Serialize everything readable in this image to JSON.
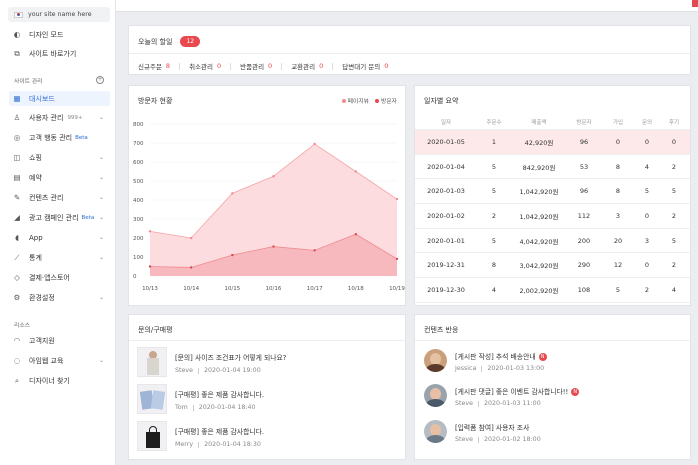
{
  "sidebar": {
    "site_name": "your site name here",
    "top_items": [
      {
        "icon": "palette-icon",
        "label": "디자인 모드"
      },
      {
        "icon": "external-link-icon",
        "label": "사이트 바로가기"
      }
    ],
    "section1": "사이트 관리",
    "items": [
      {
        "icon": "dashboard-icon",
        "label": "대시보드",
        "active": true
      },
      {
        "icon": "user-icon",
        "label": "사용자 관리",
        "count": "999+"
      },
      {
        "icon": "target-icon",
        "label": "고객 행동 관리",
        "beta": "Beta"
      },
      {
        "icon": "bag-icon",
        "label": "쇼핑"
      },
      {
        "icon": "calendar-icon",
        "label": "예약"
      },
      {
        "icon": "edit-icon",
        "label": "컨텐츠 관리"
      },
      {
        "icon": "megaphone-icon",
        "label": "광고 캠페인 관리",
        "beta": "Beta"
      },
      {
        "icon": "app-icon",
        "label": "App"
      },
      {
        "icon": "stats-icon",
        "label": "통계"
      },
      {
        "icon": "store-icon",
        "label": "결제·앱스토어"
      },
      {
        "icon": "settings-icon",
        "label": "환경설정"
      }
    ],
    "section2": "리소스",
    "resources": [
      {
        "icon": "headset-icon",
        "label": "고객지원"
      },
      {
        "icon": "bulb-icon",
        "label": "아임웹 교육"
      },
      {
        "icon": "search-icon",
        "label": "디자이너 찾기"
      }
    ]
  },
  "todo": {
    "title": "오늘의 할일",
    "count": "12",
    "items": [
      {
        "label": "신규주문",
        "value": "8"
      },
      {
        "label": "취소관리",
        "value": "0"
      },
      {
        "label": "반품관리",
        "value": "0"
      },
      {
        "label": "교환관리",
        "value": "0"
      },
      {
        "label": "답변대기 문의",
        "value": "0"
      }
    ]
  },
  "visitor": {
    "title": "방문자 현황",
    "legend": [
      {
        "label": "페이지뷰",
        "color": "#f28a8f"
      },
      {
        "label": "방문자",
        "color": "#e9484f"
      }
    ]
  },
  "chart_data": {
    "type": "area",
    "x": [
      "10/13",
      "10/14",
      "10/15",
      "10/16",
      "10/17",
      "10/18",
      "10/19"
    ],
    "ylim": [
      0,
      800
    ],
    "yticks": [
      0,
      100,
      200,
      300,
      400,
      500,
      600,
      700,
      800
    ],
    "series": [
      {
        "name": "페이지뷰",
        "values": [
          235,
          200,
          435,
          525,
          695,
          550,
          405
        ],
        "color": "#f8b9bc"
      },
      {
        "name": "방문자",
        "values": [
          50,
          45,
          110,
          155,
          135,
          220,
          90
        ],
        "color": "#f08a90"
      }
    ]
  },
  "daily": {
    "title": "일자별 요약",
    "headers": [
      "일자",
      "주문수",
      "매출액",
      "방문자",
      "가입",
      "문의",
      "후기"
    ],
    "rows": [
      [
        "2020-01-05",
        "1",
        "42,920원",
        "96",
        "0",
        "0",
        "0"
      ],
      [
        "2020-01-04",
        "5",
        "842,920원",
        "53",
        "8",
        "4",
        "2"
      ],
      [
        "2020-01-03",
        "5",
        "1,042,920원",
        "96",
        "8",
        "5",
        "5"
      ],
      [
        "2020-01-02",
        "2",
        "1,042,920원",
        "112",
        "3",
        "0",
        "2"
      ],
      [
        "2020-01-01",
        "5",
        "4,042,920원",
        "200",
        "20",
        "3",
        "5"
      ],
      [
        "2019-12-31",
        "8",
        "3,042,920원",
        "290",
        "12",
        "0",
        "2"
      ],
      [
        "2019-12-30",
        "4",
        "2,002,920원",
        "108",
        "5",
        "2",
        "4"
      ]
    ]
  },
  "inquiry": {
    "title": "문의/구매평",
    "posts": [
      {
        "title": "[문의] 사이즈 조건표가 어떻게 되나요?",
        "author": "Steve",
        "date": "2020-01-04 19:00"
      },
      {
        "title": "[구매평] 좋은 제품 감사합니다.",
        "author": "Tom",
        "date": "2020-01-04 18:40"
      },
      {
        "title": "[구매평] 좋은 제품 감사합니다.",
        "author": "Merry",
        "date": "2020-01-04 18:30"
      }
    ]
  },
  "content": {
    "title": "컨텐츠 반응",
    "posts": [
      {
        "title": "[게시판 작성] 추석 배송안내",
        "badge": "N",
        "author": "Jessica",
        "date": "2020-01-03 13:00"
      },
      {
        "title": "[게시판 댓글] 좋은 이벤트 감사합니다!!",
        "badge": "N",
        "author": "Steve",
        "date": "2020-01-03 11:00"
      },
      {
        "title": "[입력폼 참여] 사용자 조사",
        "author": "Steve",
        "date": "2020-01-02 18:00"
      }
    ]
  }
}
